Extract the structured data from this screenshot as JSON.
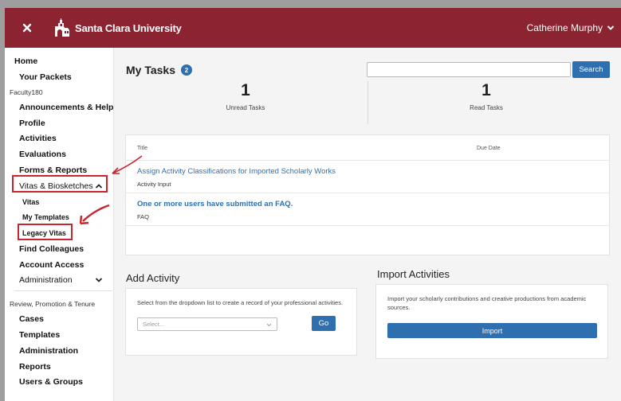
{
  "header": {
    "university": "Santa Clara University",
    "user_name": "Catherine Murphy"
  },
  "sidebar": {
    "home": "Home",
    "your_packets": "Your Packets",
    "section_faculty": "Faculty180",
    "announcements": "Announcements & Help",
    "profile": "Profile",
    "activities": "Activities",
    "evaluations": "Evaluations",
    "forms_reports": "Forms & Reports",
    "vitas_bio": "Vitas & Biosketches",
    "vitas": "Vitas",
    "my_templates": "My Templates",
    "legacy_vitas": "Legacy Vitas",
    "find_colleagues": "Find Colleagues",
    "account_access": "Account Access",
    "administration_1": "Administration",
    "section_rpt": "Review, Promotion & Tenure",
    "cases": "Cases",
    "templates": "Templates",
    "administration_2": "Administration",
    "reports": "Reports",
    "users_groups": "Users & Groups"
  },
  "main": {
    "title": "My Tasks",
    "badge": "2",
    "search": {
      "value": "",
      "button": "Search"
    },
    "unread": {
      "count": "1",
      "label": "Unread Tasks"
    },
    "read": {
      "count": "1",
      "label": "Read Tasks"
    },
    "table": {
      "col_title": "Title",
      "col_due": "Due Date",
      "rows": [
        {
          "title": "Assign Activity Classifications for Imported Scholarly Works",
          "sub": "Activity Input",
          "bold": false
        },
        {
          "title": "One or more users have submitted an FAQ.",
          "sub": "FAQ",
          "bold": true
        }
      ]
    },
    "add_activity": {
      "title": "Add Activity",
      "description": "Select from the dropdown list to create a record of your professional activities.",
      "select_placeholder": "Select...",
      "go_button": "Go"
    },
    "import_activities": {
      "title": "Import Activities",
      "description": "Import your scholarly contributions and creative productions from academic sources.",
      "import_button": "Import"
    }
  },
  "colors": {
    "header_bg": "#8b2330",
    "accent_blue": "#2f6fb0",
    "annotation_red": "#c8262f"
  }
}
